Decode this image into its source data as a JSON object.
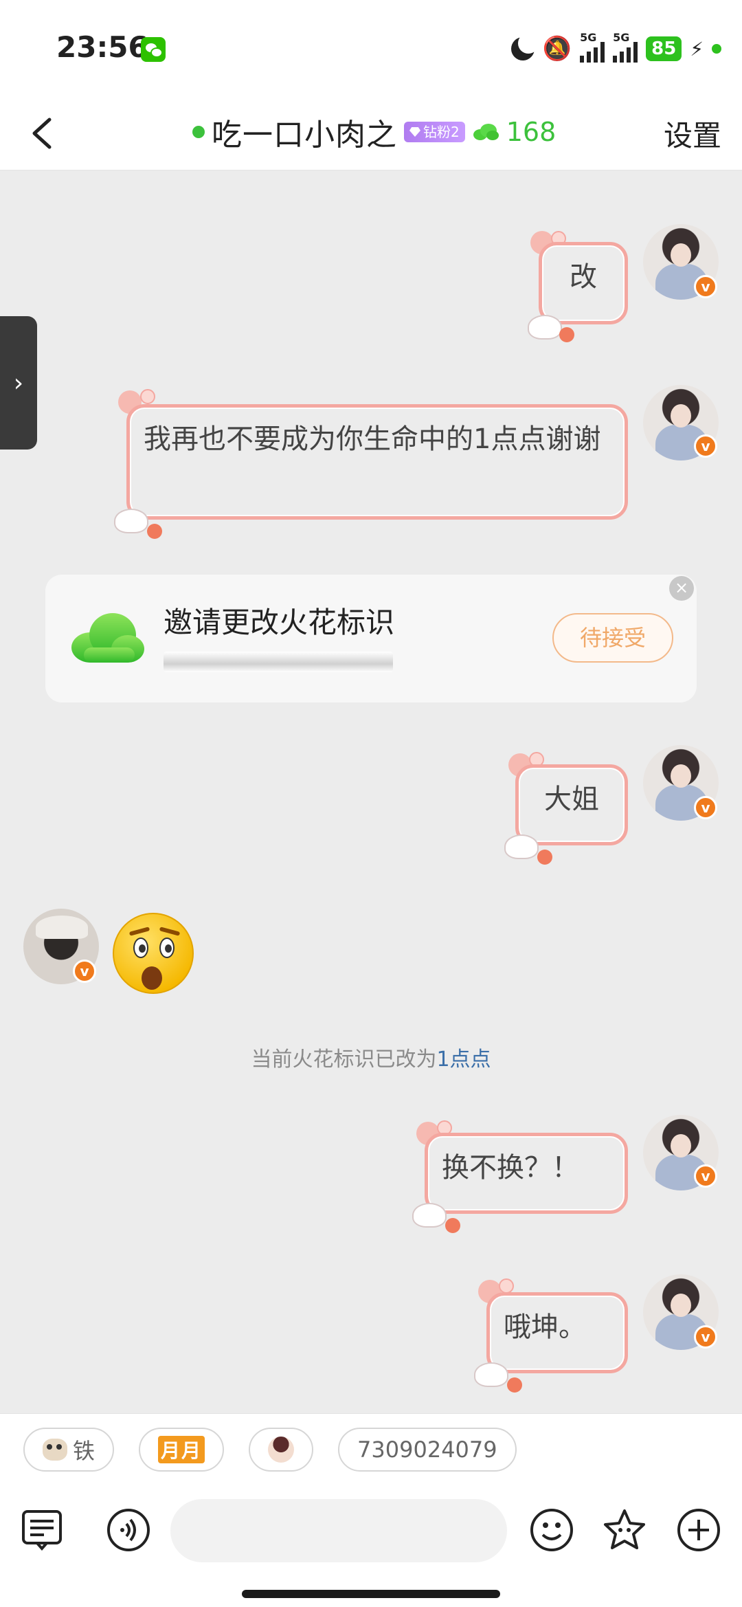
{
  "status_bar": {
    "time": "23:56",
    "network_1": "5G",
    "network_2": "5G",
    "battery": "85"
  },
  "header": {
    "title": "吃一口小肉之",
    "fan_badge": "钻粉2",
    "spark_count": "168",
    "settings": "设置"
  },
  "messages": {
    "m1": "改",
    "m2": "我再也不要成为你生命中的1点点谢谢",
    "m3": "大姐",
    "m4": "换不换？！",
    "m5": "哦坤。"
  },
  "invite_card": {
    "title": "邀请更改火花标识",
    "button": "待接受"
  },
  "system_note": {
    "prefix": "当前火花标识已改为",
    "highlight": "1点点"
  },
  "chips": {
    "chip1": "铁",
    "chip2": "月月",
    "chip4": "7309024079"
  },
  "icons": {
    "back": "chevron-left-icon",
    "sidebar_toggle": "chevron-right-icon",
    "menu": "menu-icon",
    "voice": "voice-icon",
    "emoji": "smiley-icon",
    "sticker": "star-face-icon",
    "add": "plus-icon"
  },
  "colors": {
    "accent_green": "#3cc13c",
    "bubble_border": "#f4a7a0",
    "invite_button": "#f0a868",
    "link_blue": "#3a6ea8",
    "verified_orange": "#f07a1c"
  }
}
